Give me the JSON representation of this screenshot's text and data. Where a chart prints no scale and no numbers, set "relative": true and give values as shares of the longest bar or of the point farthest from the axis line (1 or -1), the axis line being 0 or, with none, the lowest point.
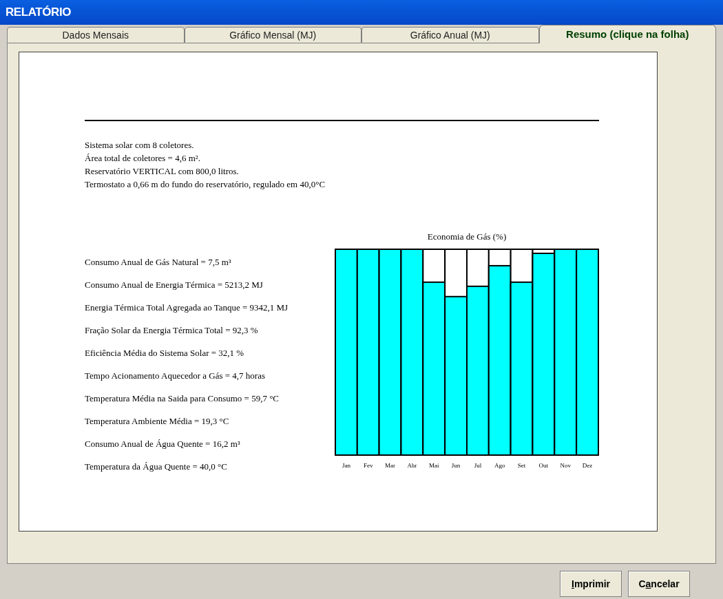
{
  "window": {
    "title": "RELATÓRIO"
  },
  "tabs": [
    {
      "label": "Dados Mensais",
      "selected": false
    },
    {
      "label": "Gráfico Mensal (MJ)",
      "selected": false
    },
    {
      "label": "Gráfico Anual (MJ)",
      "selected": false
    },
    {
      "label": "Resumo (clique na folha)",
      "selected": true
    }
  ],
  "report": {
    "header_lines": [
      "Sistema solar com 8 coletores.",
      "Área total de coletores = 4,6 m².",
      "Reservatório VERTICAL com 800,0 litros.",
      "Termostato a 0,66 m do fundo do reservatório, regulado em 40,0°C"
    ],
    "stats": [
      "Consumo Anual de Gás Natural = 7,5 m³",
      "Consumo Anual de Energia Térmica = 5213,2 MJ",
      "Energia Térmica Total Agregada ao Tanque = 9342,1 MJ",
      "Fração Solar da Energia Térmica Total = 92,3 %",
      "Eficiência Média do Sistema Solar = 32,1 %",
      "Tempo Acionamento Aquecedor a Gás = 4,7 horas",
      "Temperatura Média na Saida para Consumo = 59,7 °C",
      "Temperatura Ambiente Média  = 19,3 °C",
      "Consumo Anual de Água Quente = 16,2 m³",
      "Temperatura da Água Quente = 40,0 °C"
    ],
    "chart_data": {
      "type": "bar",
      "title": "Economia de Gás (%)",
      "categories": [
        "Jan",
        "Fev",
        "Mar",
        "Abr",
        "Mai",
        "Jun",
        "Jul",
        "Ago",
        "Set",
        "Out",
        "Nov",
        "Dez"
      ],
      "relative": true,
      "series": [
        {
          "color": "#00ffff",
          "values": [
            1,
            1,
            1,
            1,
            0.84,
            0.77,
            0.82,
            0.92,
            0.84,
            0.98,
            1,
            1
          ]
        }
      ]
    }
  },
  "buttons": [
    {
      "key": "I",
      "after": "mprimir"
    },
    {
      "before": "C",
      "key": "a",
      "after": "ncelar"
    }
  ]
}
